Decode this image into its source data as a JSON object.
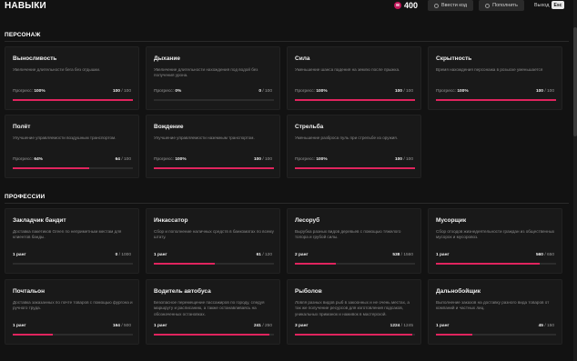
{
  "header": {
    "title": "НАВЫКИ",
    "coin_glyph": "м",
    "balance": "400",
    "enter_code_label": "Ввести код",
    "topup_label": "Пополнить",
    "exit_label": "Выход",
    "esc_label": "Esc"
  },
  "colors": {
    "accent": "#e0245e",
    "background": "#121212",
    "card": "#191919"
  },
  "character": {
    "title": "ПЕРСОНАЖ",
    "progress_label": "Прогресс:",
    "skills": [
      {
        "name": "Выносливость",
        "desc": "Увеличение длительности бега без отдышки.",
        "percent": "100%",
        "value": "100",
        "max": "100",
        "progress": 1.0
      },
      {
        "name": "Дыхание",
        "desc": "Увеличение длительности нахождения под водой без получения урона.",
        "percent": "0%",
        "value": "0",
        "max": "100",
        "progress": 0.0
      },
      {
        "name": "Сила",
        "desc": "Уменьшение шанса падения на землю после прыжка.",
        "percent": "100%",
        "value": "100",
        "max": "100",
        "progress": 1.0
      },
      {
        "name": "Скрытность",
        "desc": "Время нахождения персонажа в розыске уменьшается",
        "percent": "100%",
        "value": "100",
        "max": "100",
        "progress": 1.0
      },
      {
        "name": "Полёт",
        "desc": "Улучшение управляемости воздушным транспортом.",
        "percent": "64%",
        "value": "64",
        "max": "100",
        "progress": 0.64
      },
      {
        "name": "Вождение",
        "desc": "Улучшение управляемости наземным транспортом.",
        "percent": "100%",
        "value": "100",
        "max": "100",
        "progress": 1.0
      },
      {
        "name": "Стрельба",
        "desc": "Уменьшение разброса пуль при стрельбе из оружия.",
        "percent": "100%",
        "value": "100",
        "max": "100",
        "progress": 1.0
      }
    ]
  },
  "professions": {
    "title": "ПРОФЕССИИ",
    "items": [
      {
        "name": "Закладчик бандит",
        "desc": "Доставка пакетиков Green по неприметным местам для клиентов банды.",
        "rank": "1 ранг",
        "value": "0",
        "max": "1000",
        "progress": 0.0
      },
      {
        "name": "Инкассатор",
        "desc": "Сбор и пополнение наличных средств в банкоматах по всему штату.",
        "rank": "1 ранг",
        "value": "61",
        "max": "120",
        "progress": 0.51
      },
      {
        "name": "Лесоруб",
        "desc": "Вырубка разных видов деревьев с помощью тяжелого топора и грубой силы.",
        "rank": "2 ранг",
        "value": "538",
        "max": "1560",
        "progress": 0.34
      },
      {
        "name": "Мусорщик",
        "desc": "Сбор отходов жизнедеятельности граждан из общественных мусорок и мусоровоз.",
        "rank": "1 ранг",
        "value": "560",
        "max": "650",
        "progress": 0.86
      },
      {
        "name": "Почтальон",
        "desc": "Доставка заказанных по почте товаров с помощью фургона и ручного труда.",
        "rank": "1 ранг",
        "value": "164",
        "max": "500",
        "progress": 0.33
      },
      {
        "name": "Водитель автобуса",
        "desc": "Безопасное перемещение пассажиров по городу, следуя маршруту и расписанию, а также останавливаясь на обозначенных остановках.",
        "rank": "1 ранг",
        "value": "241",
        "max": "250",
        "progress": 0.96
      },
      {
        "name": "Рыболов",
        "desc": "Ловля разных видов рыб в закоонных и не очень местах, а так же получение ресурсов для изготовления подсаков, уникальных приманок и наживок в мастерской.",
        "rank": "3 ранг",
        "value": "1224",
        "max": "1245",
        "progress": 0.98
      },
      {
        "name": "Дальнобойщик",
        "desc": "Выполнение заказов на доставку разного вида товаров от компаний и частных лиц.",
        "rank": "1 ранг",
        "value": "45",
        "max": "150",
        "progress": 0.3
      }
    ]
  }
}
